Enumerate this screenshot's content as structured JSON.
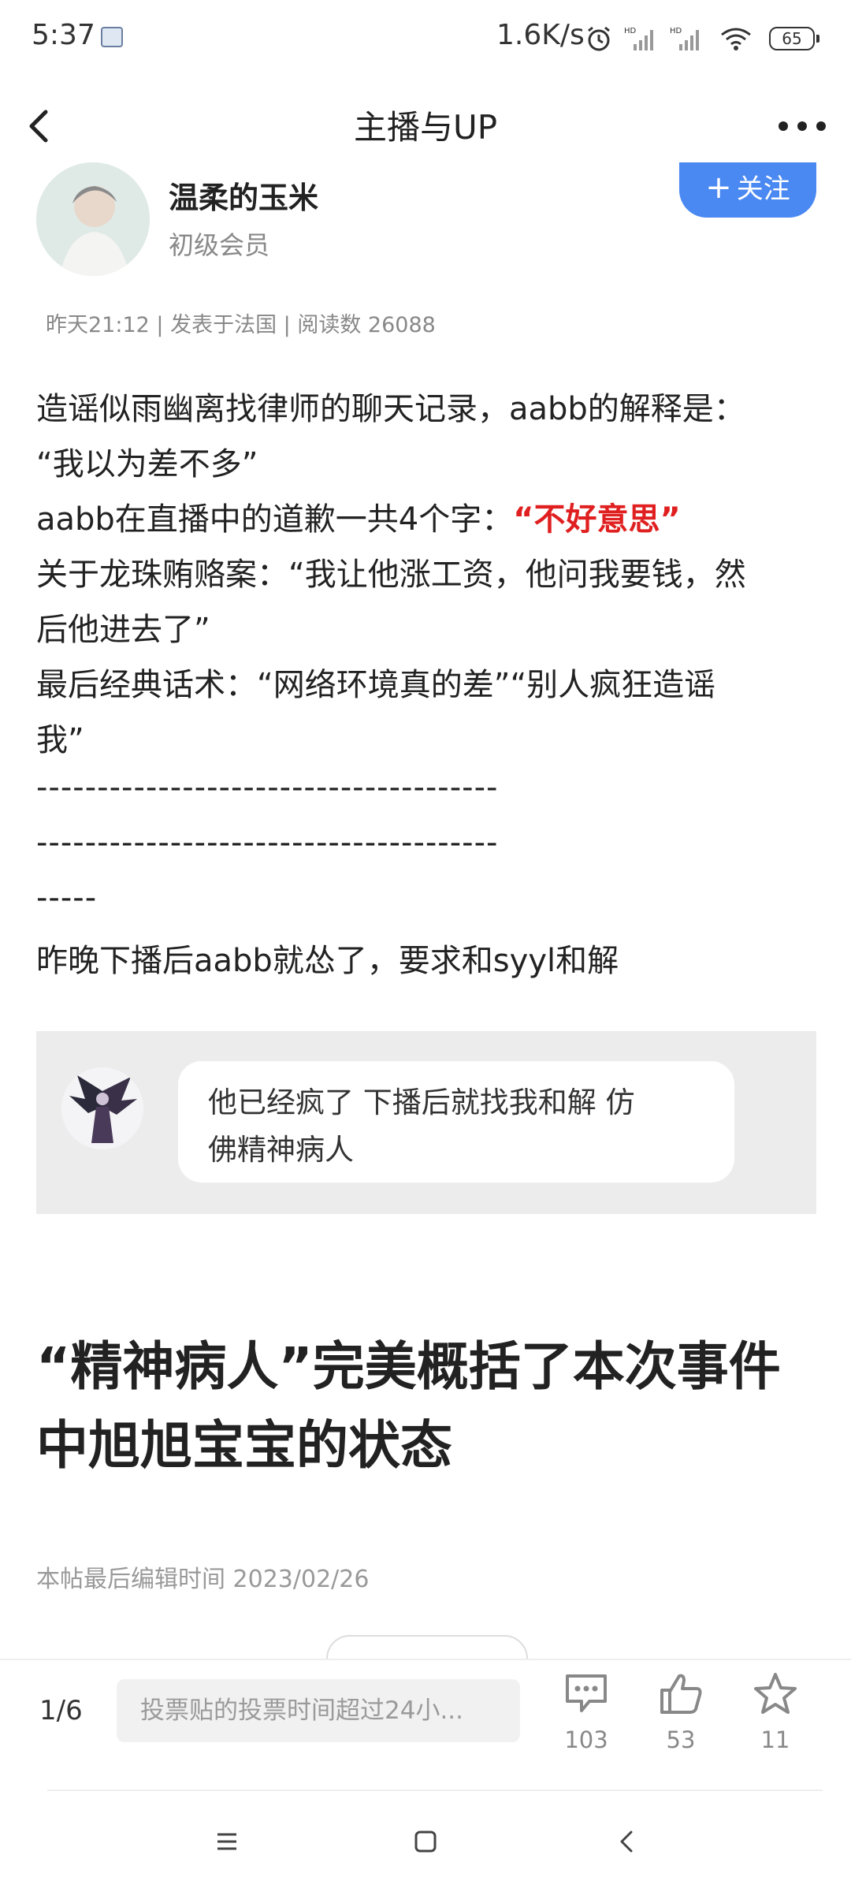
{
  "status_bar": {
    "time": "5:37",
    "speed": "1.6K/s",
    "battery": "65"
  },
  "header": {
    "title": "主播与UP"
  },
  "author": {
    "name": "温柔的玉米",
    "level": "初级会员",
    "follow_label": "关注"
  },
  "post_meta": "昨天21:12 | 发表于法国 | 阅读数 26088",
  "content": {
    "l1": "造谣似雨幽离找律师的聊天记录，aabb的解释是：",
    "l2": "“我以为差不多”",
    "l3a": "aabb在直播中的道歉一共4个字：",
    "l3b": "“不好意思”",
    "l4": "关于龙珠贿赂案：“我让他涨工资，他问我要钱，然",
    "l5": "后他进去了”",
    "l6": "最后经典话术：“网络环境真的差”“别人疯狂造谣",
    "l7": "我”",
    "l8": "--------------------------------------",
    "l9": "--------------------------------------",
    "l10": "-----",
    "l11": "昨晚下播后aabb就怂了，要求和syyl和解"
  },
  "quote": {
    "line1": "他已经疯了 下播后就找我和解 仿",
    "line2": "佛精神病人"
  },
  "headline": {
    "line1": "“精神病人”完美概括了本次事件",
    "line2": "中旭旭宝宝的状态"
  },
  "edit_time": "本帖最后编辑时间 2023/02/26",
  "bottom_bar": {
    "page": "1/6",
    "reply_placeholder": "投票贴的投票时间超过24小...",
    "comments": "103",
    "likes": "53",
    "favorites": "11"
  },
  "colors": {
    "accent": "#4a88f2",
    "highlight": "#e02020"
  },
  "icons": [
    "back-icon",
    "more-icon",
    "comment-icon",
    "thumbs-up-icon",
    "star-icon",
    "menu-icon",
    "home-icon",
    "nav-back-icon"
  ]
}
